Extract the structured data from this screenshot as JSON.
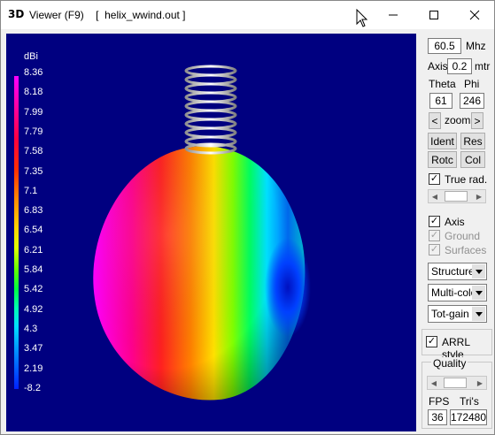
{
  "window": {
    "app_icon_text": "3D",
    "title": "Viewer (F9)    [  helix_wwind.out ]",
    "controls": {
      "minimize": "minimize",
      "maximize": "maximize",
      "close": "close"
    }
  },
  "legend": {
    "unit": "dBi",
    "values": [
      "8.36",
      "8.18",
      "7.99",
      "7.79",
      "7.58",
      "7.35",
      "7.1",
      "6.83",
      "6.54",
      "6.21",
      "5.84",
      "5.42",
      "4.92",
      "4.3",
      "3.47",
      "2.19",
      "-8.2"
    ]
  },
  "panel": {
    "frequency_value": "60.5",
    "frequency_unit": "Mhz",
    "axis_label": "Axis",
    "axis_value": "0.2",
    "axis_unit": "mtr",
    "theta_label": "Theta",
    "phi_label": "Phi",
    "theta_value": "61",
    "phi_value": "246",
    "zoom_prev": "<",
    "zoom_label": "zoom",
    "zoom_next": ">",
    "ident_button": "Ident",
    "res_button": "Res",
    "rotc_button": "Rotc",
    "col_button": "Col",
    "true_rad_label": "True rad.",
    "true_rad_checked": true,
    "axis_check_label": "Axis",
    "axis_checked": true,
    "ground_label": "Ground",
    "ground_checked": true,
    "surfaces_label": "Surfaces",
    "surfaces_checked": true,
    "structure_select": "Structure",
    "color_select": "Multi-colo",
    "gain_select": "Tot-gain",
    "arrl_label": "ARRL style",
    "arrl_checked": true,
    "quality_label": "Quality",
    "fps_label": "FPS",
    "tris_label": "Tri's",
    "fps_value": "36",
    "tris_value": "172480"
  }
}
